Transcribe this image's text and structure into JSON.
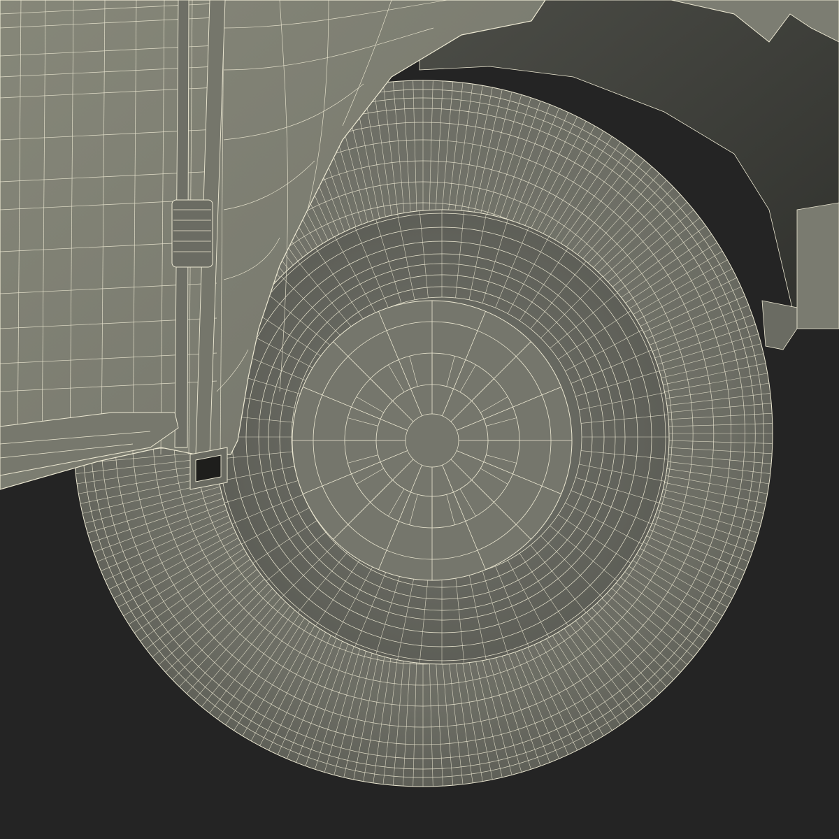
{
  "scene": {
    "subject": "wireframe-render-vehicle-wheel",
    "background_color": "#242424",
    "body_color": "#7d7e74",
    "wire_color": "#ece8d2",
    "tire_color": "#6f7067",
    "rim_color": "#6a6b63"
  }
}
